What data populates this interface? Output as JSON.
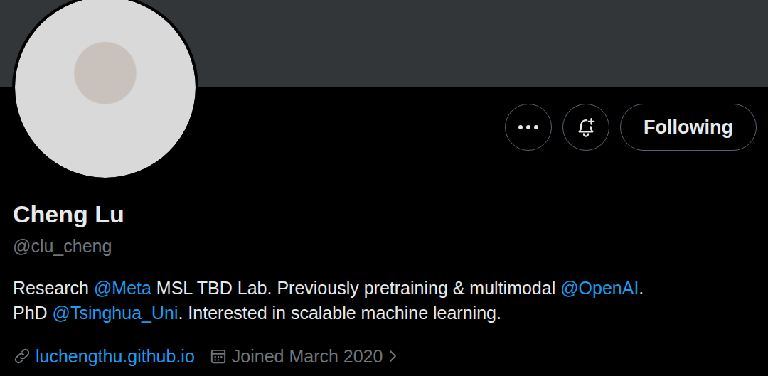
{
  "profile": {
    "name": "Cheng Lu",
    "handle": "@clu_cheng"
  },
  "actions": {
    "follow_button": {
      "label": "Following",
      "following": true
    }
  },
  "bio": {
    "lines": [
      [
        {
          "kind": "text",
          "text": "Research "
        },
        {
          "kind": "mention",
          "text": "@Meta"
        },
        {
          "kind": "text",
          "text": " MSL TBD Lab. Previously pretraining & multimodal "
        },
        {
          "kind": "mention",
          "text": "@OpenAI"
        },
        {
          "kind": "text",
          "text": "."
        }
      ],
      [
        {
          "kind": "text",
          "text": "PhD "
        },
        {
          "kind": "mention",
          "text": "@Tsinghua_Uni"
        },
        {
          "kind": "text",
          "text": ". Interested in scalable machine learning."
        }
      ]
    ]
  },
  "meta": {
    "website": "luchengthu.github.io",
    "joined": "Joined March 2020"
  }
}
